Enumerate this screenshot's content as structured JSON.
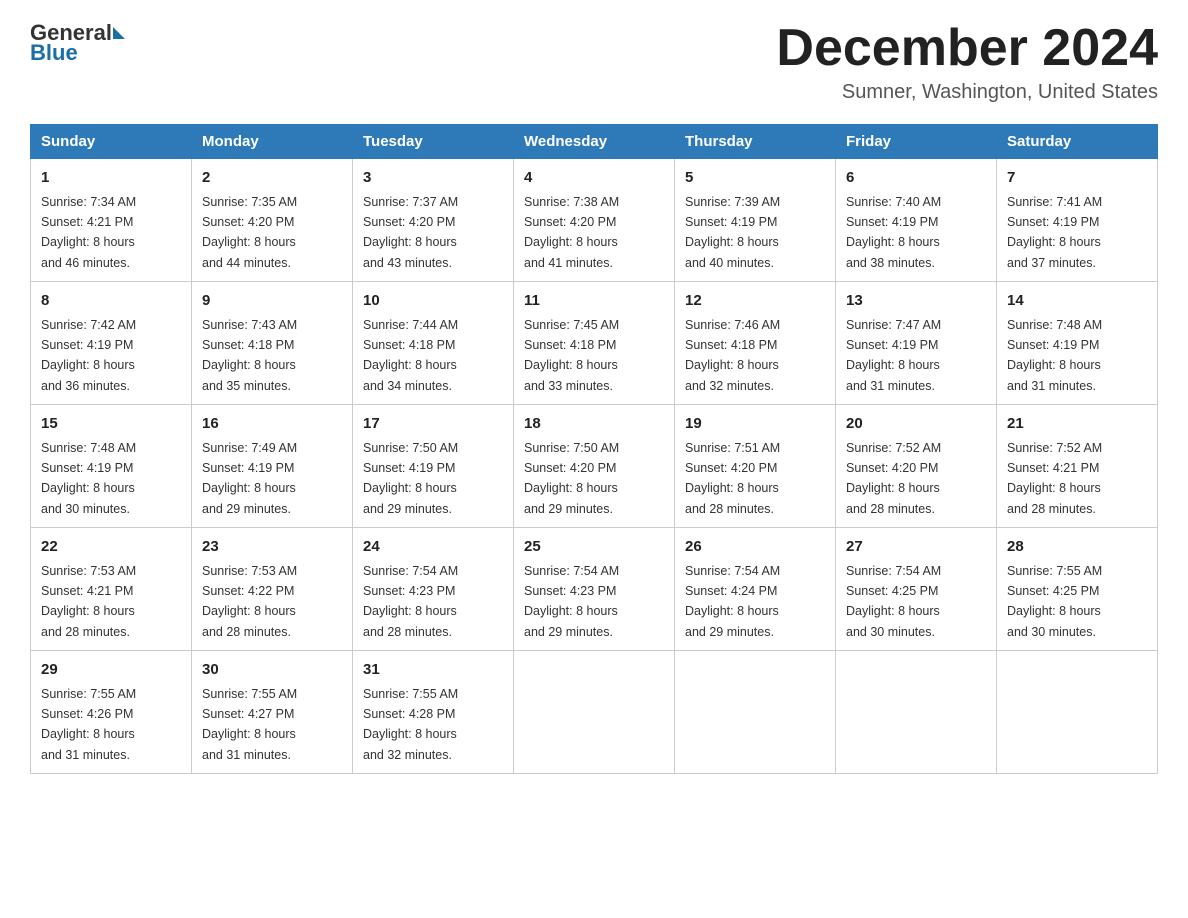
{
  "header": {
    "logo_general": "General",
    "logo_blue": "Blue",
    "month_title": "December 2024",
    "location": "Sumner, Washington, United States"
  },
  "weekdays": [
    "Sunday",
    "Monday",
    "Tuesday",
    "Wednesday",
    "Thursday",
    "Friday",
    "Saturday"
  ],
  "weeks": [
    [
      {
        "day": "1",
        "sunrise": "7:34 AM",
        "sunset": "4:21 PM",
        "daylight": "8 hours and 46 minutes."
      },
      {
        "day": "2",
        "sunrise": "7:35 AM",
        "sunset": "4:20 PM",
        "daylight": "8 hours and 44 minutes."
      },
      {
        "day": "3",
        "sunrise": "7:37 AM",
        "sunset": "4:20 PM",
        "daylight": "8 hours and 43 minutes."
      },
      {
        "day": "4",
        "sunrise": "7:38 AM",
        "sunset": "4:20 PM",
        "daylight": "8 hours and 41 minutes."
      },
      {
        "day": "5",
        "sunrise": "7:39 AM",
        "sunset": "4:19 PM",
        "daylight": "8 hours and 40 minutes."
      },
      {
        "day": "6",
        "sunrise": "7:40 AM",
        "sunset": "4:19 PM",
        "daylight": "8 hours and 38 minutes."
      },
      {
        "day": "7",
        "sunrise": "7:41 AM",
        "sunset": "4:19 PM",
        "daylight": "8 hours and 37 minutes."
      }
    ],
    [
      {
        "day": "8",
        "sunrise": "7:42 AM",
        "sunset": "4:19 PM",
        "daylight": "8 hours and 36 minutes."
      },
      {
        "day": "9",
        "sunrise": "7:43 AM",
        "sunset": "4:18 PM",
        "daylight": "8 hours and 35 minutes."
      },
      {
        "day": "10",
        "sunrise": "7:44 AM",
        "sunset": "4:18 PM",
        "daylight": "8 hours and 34 minutes."
      },
      {
        "day": "11",
        "sunrise": "7:45 AM",
        "sunset": "4:18 PM",
        "daylight": "8 hours and 33 minutes."
      },
      {
        "day": "12",
        "sunrise": "7:46 AM",
        "sunset": "4:18 PM",
        "daylight": "8 hours and 32 minutes."
      },
      {
        "day": "13",
        "sunrise": "7:47 AM",
        "sunset": "4:19 PM",
        "daylight": "8 hours and 31 minutes."
      },
      {
        "day": "14",
        "sunrise": "7:48 AM",
        "sunset": "4:19 PM",
        "daylight": "8 hours and 31 minutes."
      }
    ],
    [
      {
        "day": "15",
        "sunrise": "7:48 AM",
        "sunset": "4:19 PM",
        "daylight": "8 hours and 30 minutes."
      },
      {
        "day": "16",
        "sunrise": "7:49 AM",
        "sunset": "4:19 PM",
        "daylight": "8 hours and 29 minutes."
      },
      {
        "day": "17",
        "sunrise": "7:50 AM",
        "sunset": "4:19 PM",
        "daylight": "8 hours and 29 minutes."
      },
      {
        "day": "18",
        "sunrise": "7:50 AM",
        "sunset": "4:20 PM",
        "daylight": "8 hours and 29 minutes."
      },
      {
        "day": "19",
        "sunrise": "7:51 AM",
        "sunset": "4:20 PM",
        "daylight": "8 hours and 28 minutes."
      },
      {
        "day": "20",
        "sunrise": "7:52 AM",
        "sunset": "4:20 PM",
        "daylight": "8 hours and 28 minutes."
      },
      {
        "day": "21",
        "sunrise": "7:52 AM",
        "sunset": "4:21 PM",
        "daylight": "8 hours and 28 minutes."
      }
    ],
    [
      {
        "day": "22",
        "sunrise": "7:53 AM",
        "sunset": "4:21 PM",
        "daylight": "8 hours and 28 minutes."
      },
      {
        "day": "23",
        "sunrise": "7:53 AM",
        "sunset": "4:22 PM",
        "daylight": "8 hours and 28 minutes."
      },
      {
        "day": "24",
        "sunrise": "7:54 AM",
        "sunset": "4:23 PM",
        "daylight": "8 hours and 28 minutes."
      },
      {
        "day": "25",
        "sunrise": "7:54 AM",
        "sunset": "4:23 PM",
        "daylight": "8 hours and 29 minutes."
      },
      {
        "day": "26",
        "sunrise": "7:54 AM",
        "sunset": "4:24 PM",
        "daylight": "8 hours and 29 minutes."
      },
      {
        "day": "27",
        "sunrise": "7:54 AM",
        "sunset": "4:25 PM",
        "daylight": "8 hours and 30 minutes."
      },
      {
        "day": "28",
        "sunrise": "7:55 AM",
        "sunset": "4:25 PM",
        "daylight": "8 hours and 30 minutes."
      }
    ],
    [
      {
        "day": "29",
        "sunrise": "7:55 AM",
        "sunset": "4:26 PM",
        "daylight": "8 hours and 31 minutes."
      },
      {
        "day": "30",
        "sunrise": "7:55 AM",
        "sunset": "4:27 PM",
        "daylight": "8 hours and 31 minutes."
      },
      {
        "day": "31",
        "sunrise": "7:55 AM",
        "sunset": "4:28 PM",
        "daylight": "8 hours and 32 minutes."
      },
      null,
      null,
      null,
      null
    ]
  ],
  "labels": {
    "sunrise": "Sunrise:",
    "sunset": "Sunset:",
    "daylight": "Daylight:"
  }
}
